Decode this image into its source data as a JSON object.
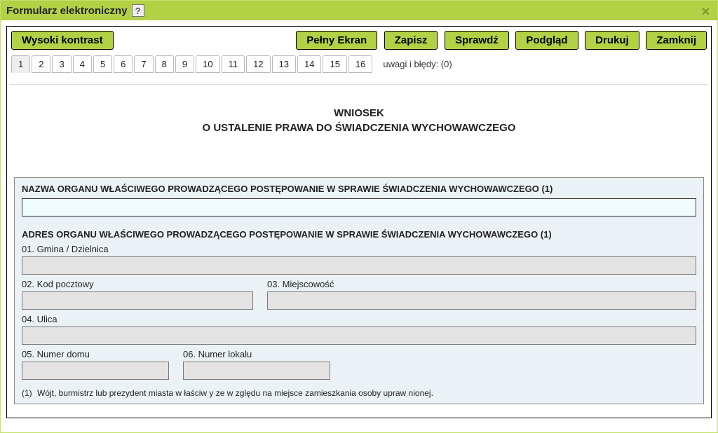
{
  "window": {
    "title": "Formularz elektroniczny"
  },
  "toolbar": {
    "contrast": "Wysoki kontrast",
    "fullscreen": "Pełny Ekran",
    "save": "Zapisz",
    "check": "Sprawdź",
    "preview": "Podgląd",
    "print": "Drukuj",
    "close": "Zamknij"
  },
  "tabs": [
    "1",
    "2",
    "3",
    "4",
    "5",
    "6",
    "7",
    "8",
    "9",
    "10",
    "11",
    "12",
    "13",
    "14",
    "15",
    "16"
  ],
  "errors_label": "uwagi i błędy: (0)",
  "document": {
    "title_line1": "WNIOSEK",
    "title_line2": "O USTALENIE PRAWA DO ŚWIADCZENIA WYCHOWAWCZEGO",
    "section1_label": "NAZWA ORGANU WŁAŚCIWEGO PROWADZĄCEGO POSTĘPOWANIE W SPRAWIE ŚWIADCZENIA WYCHOWAWCZEGO (1)",
    "section2_label": "ADRES ORGANU WŁAŚCIWEGO PROWADZĄCEGO POSTĘPOWANIE W SPRAWIE ŚWIADCZENIA WYCHOWAWCZEGO (1)",
    "field01": "01. Gmina / Dzielnica",
    "field02": "02. Kod pocztowy",
    "field03": "03. Miejscowość",
    "field04": "04. Ulica",
    "field05": "05. Numer domu",
    "field06": "06. Numer lokalu",
    "footnote_num": "(1)",
    "footnote_text": "Wójt, burmistrz lub prezydent miasta w łaściw y ze w zględu na miejsce zamieszkania osoby upraw nionej."
  }
}
